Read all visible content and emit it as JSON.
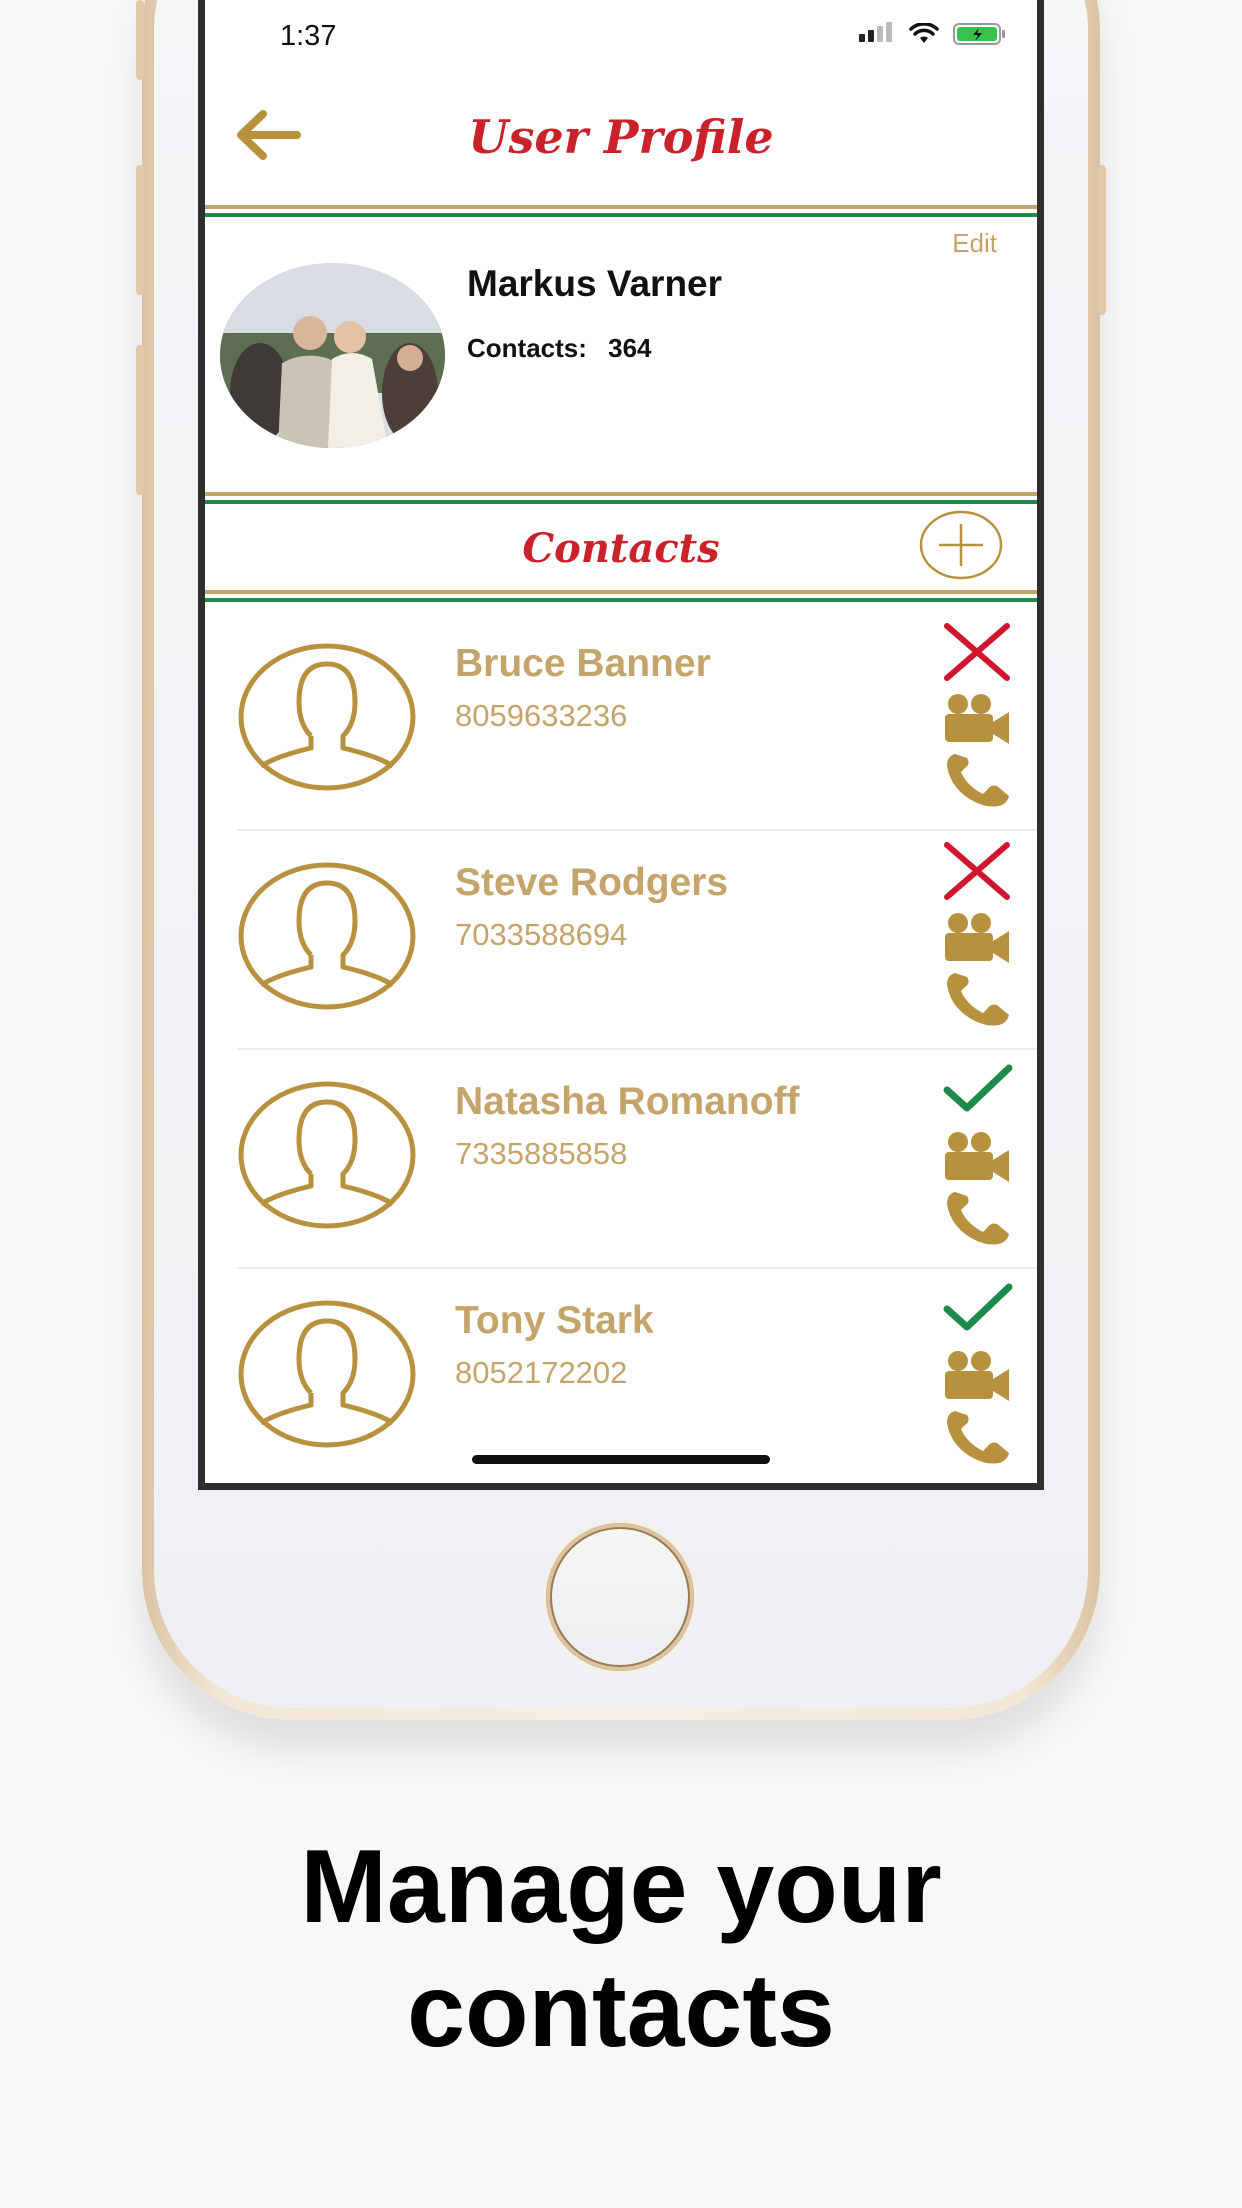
{
  "status_bar": {
    "time": "1:37"
  },
  "header": {
    "title": "User Profile"
  },
  "profile": {
    "edit_label": "Edit",
    "name": "Markus Varner",
    "contacts_label": "Contacts:",
    "contacts_count": "364"
  },
  "contacts_section": {
    "title": "Contacts"
  },
  "contacts": [
    {
      "name": "Bruce Banner",
      "phone": "8059633236",
      "status": "removed"
    },
    {
      "name": "Steve Rodgers",
      "phone": "7033588694",
      "status": "removed"
    },
    {
      "name": "Natasha Romanoff",
      "phone": "7335885858",
      "status": "confirmed"
    },
    {
      "name": "Tony Stark",
      "phone": "8052172202",
      "status": "confirmed"
    }
  ],
  "caption": {
    "line1": "Manage your",
    "line2": "contacts"
  },
  "colors": {
    "accent_red": "#c9222a",
    "gold": "#c4a46a",
    "green": "#1d8a4b",
    "x_red": "#d0152f"
  }
}
